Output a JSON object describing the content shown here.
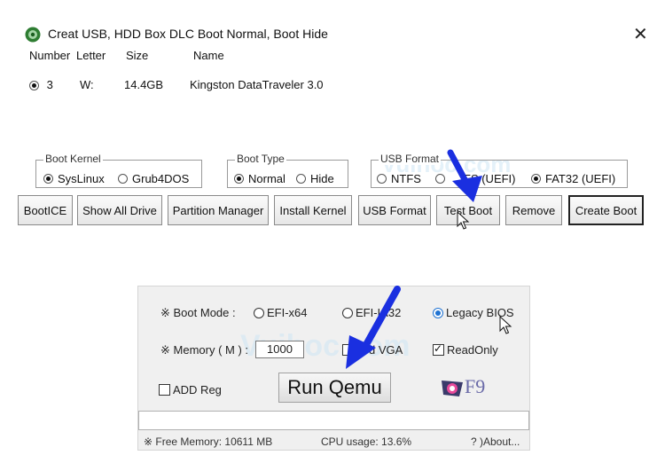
{
  "dialog": {
    "title": "Creat USB, HDD Box DLC Boot Normal, Boot Hide",
    "close_icon": "close-icon",
    "columns": [
      "Number",
      "Letter",
      "Size",
      "Name"
    ],
    "drive": {
      "number": "3",
      "letter": "W:",
      "size": "14.4GB",
      "name": "Kingston DataTraveler 3.0",
      "selected": true
    }
  },
  "boot_kernel": {
    "label": "Boot Kernel",
    "options": [
      "SysLinux",
      "Grub4DOS"
    ],
    "selected": "SysLinux"
  },
  "boot_type": {
    "label": "Boot Type",
    "options": [
      "Normal",
      "Hide"
    ],
    "selected": "Normal"
  },
  "usb_format": {
    "label": "USB Format",
    "options": [
      "NTFS",
      "NTFS (UEFI)",
      "FAT32 (UEFI)"
    ],
    "visible_text": [
      "NTFS",
      "FS (UEFI)",
      "FAT32 (UEFI)"
    ],
    "selected": "FAT32 (UEFI)"
  },
  "toolbar": {
    "bootice": "BootICE",
    "show_all_drive": "Show All Drive",
    "partition_manager": "Partition Manager",
    "install_kernel": "Install Kernel",
    "usb_format": "USB Format",
    "test_boot": "Test Boot",
    "remove": "Remove",
    "create_boot": "Create Boot"
  },
  "qemu": {
    "boot_mode_label": "※ Boot Mode :",
    "boot_modes": [
      "EFI-x64",
      "EFI-IA32",
      "Legacy BIOS"
    ],
    "visible_text": {
      "efi_ia32": "EFI-IA32",
      "legacy_bios": "Legacy BIOS"
    },
    "selected_boot_mode": "Legacy BIOS",
    "memory_label": "※ Memory ( M ) :",
    "memory_value": "1000",
    "std_vga_label": "Std VGA",
    "std_vga_visible": "d VGA",
    "std_vga_checked": false,
    "readonly_label": "ReadOnly",
    "readonly_checked": true,
    "add_reg_label": "ADD Reg",
    "add_reg_checked": false,
    "run_button": "Run Qemu",
    "f9_label": "F9",
    "status": {
      "free_memory": "※ Free Memory: 10611 MB",
      "cpu_usage": "CPU usage: 13.6%",
      "about": "? )About..."
    }
  },
  "watermark": "Vuihoc.com",
  "colors": {
    "arrow": "#1a2fe0",
    "radio_selected": "#1e72d2"
  }
}
